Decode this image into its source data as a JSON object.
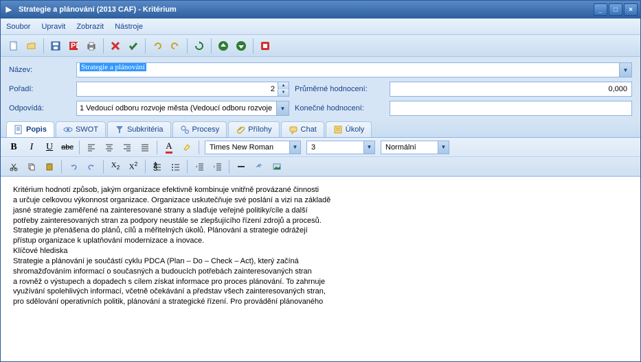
{
  "window": {
    "title": "Strategie a plánování  (2013 CAF) - Kritérium"
  },
  "menu": {
    "soubor": "Soubor",
    "upravit": "Upravit",
    "zobrazit": "Zobrazit",
    "nastroje": "Nástroje"
  },
  "form": {
    "nazev_label": "Název:",
    "nazev_value": "Strategie a plánování",
    "poradi_label": "Pořadí:",
    "poradi_value": "2",
    "odpovida_label": "Odpovídá:",
    "odpovida_value": "1 Vedoucí odboru rozvoje města (Vedoucí odboru rozvoje ...",
    "prum_label": "Průměrné hodnocení:",
    "prum_value": "0,000",
    "konec_label": "Konečné hodnocení:",
    "konec_value": ""
  },
  "tabs": {
    "popis": "Popis",
    "swot": "SWOT",
    "subkriteria": "Subkritéria",
    "procesy": "Procesy",
    "prilohy": "Přílohy",
    "chat": "Chat",
    "ukoly": "Úkoly"
  },
  "editor": {
    "font": "Times New Roman",
    "size": "3",
    "style": "Normální"
  },
  "body": {
    "p1": "Kritérium hodnotí způsob, jakým organizace efektivně kombinuje vnitřně provázané činnosti",
    "p2": "a určuje celkovou výkonnost organizace. Organizace uskutečňuje své poslání a vizi na základě",
    "p3": "jasné strategie zaměřené na zainteresované strany a slaďuje veřejné politiky/cíle a další",
    "p4": "potřeby zainteresovaných stran za podpory neustále se zlepšujícího řízení zdrojů a procesů.",
    "p5": "Strategie je přenášena do plánů, cílů a měřitelných úkolů. Plánování a strategie odrážejí",
    "p6": "přístup organizace k uplatňování modernizace a inovace.",
    "p7": "Klíčové hlediska",
    "p8": "Strategie a plánování je součástí cyklu PDCA (Plan – Do – Check – Act), který začíná",
    "p9": "shromažďováním informací o současných a budoucích potřebách zainteresovaných stran",
    "p10": "a rovněž o výstupech a dopadech s cílem získat informace pro proces plánování. To zahrnuje",
    "p11": "využívání spolehlivých informací, včetně očekávání a představ všech zainteresovaných stran,",
    "p12": "pro sdělování operativních politik, plánování a strategické řízení. Pro provádění plánovaného"
  }
}
